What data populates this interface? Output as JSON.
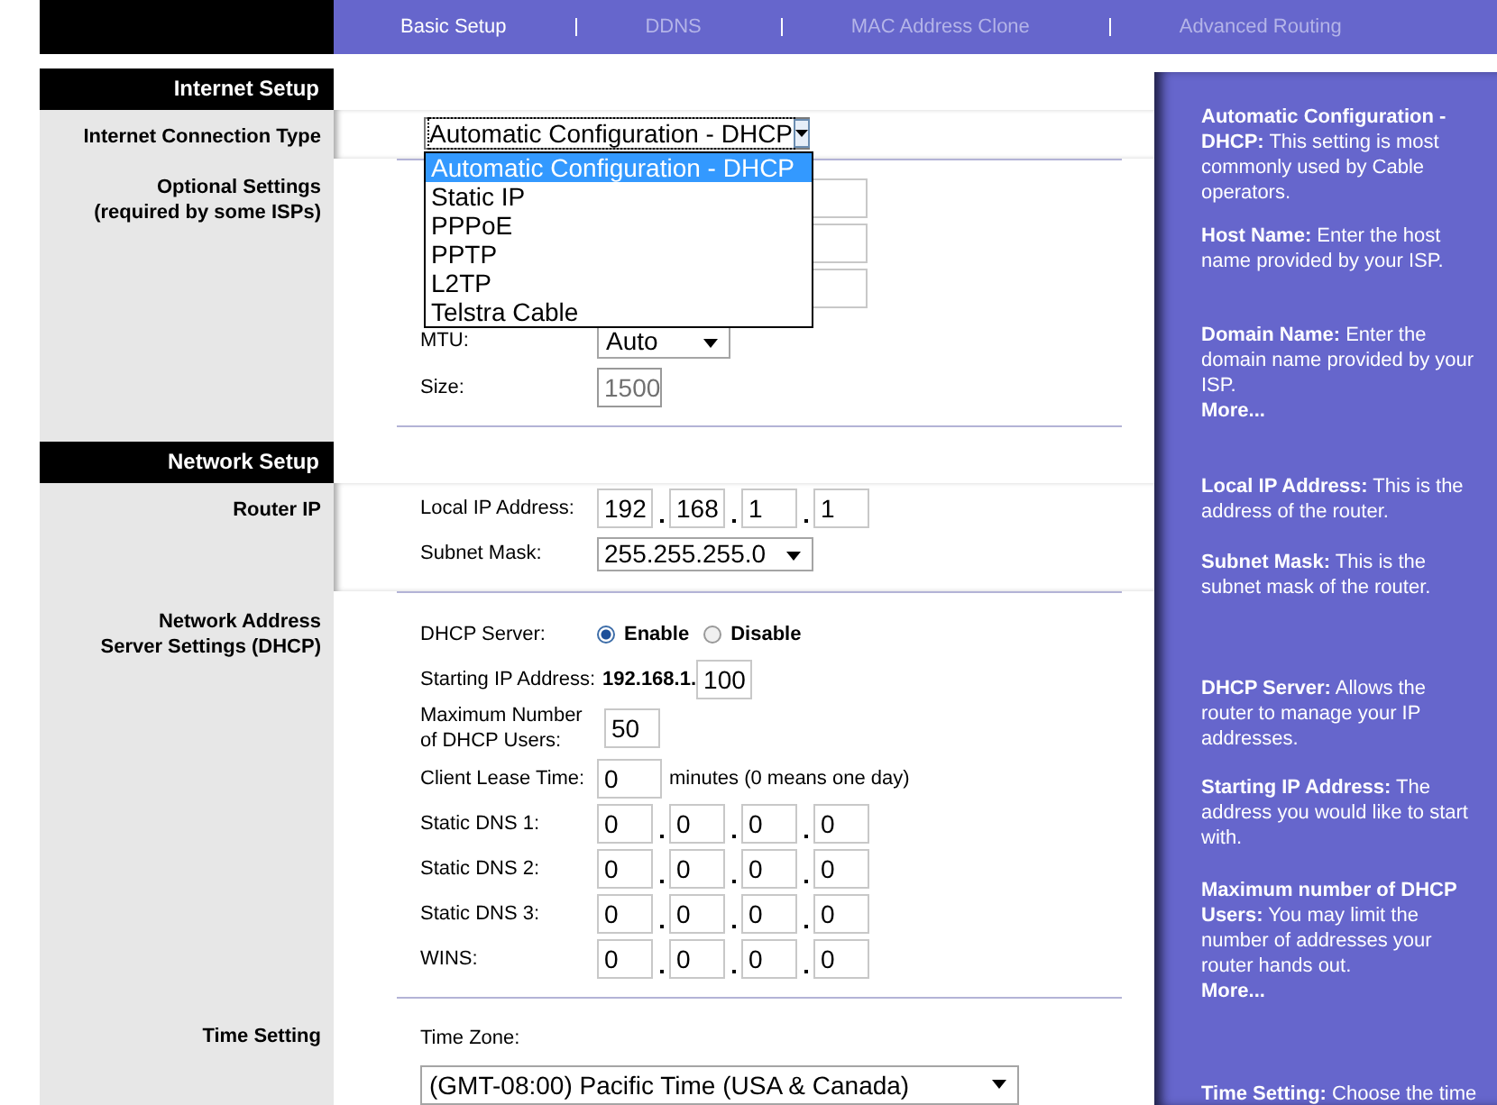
{
  "tabs": [
    {
      "label": "Basic Setup",
      "selected": true
    },
    {
      "label": "DDNS",
      "selected": false
    },
    {
      "label": "MAC Address Clone",
      "selected": false
    },
    {
      "label": "Advanced Routing",
      "selected": false
    }
  ],
  "internet_setup": {
    "title": "Internet Setup",
    "connection_type_label": "Internet Connection Type",
    "connection_type": {
      "value": "Automatic Configuration - DHCP",
      "expanded": true,
      "options": [
        {
          "label": "Automatic Configuration - DHCP",
          "selected": true
        },
        {
          "label": "Static IP",
          "selected": false
        },
        {
          "label": "PPPoE",
          "selected": false
        },
        {
          "label": "PPTP",
          "selected": false
        },
        {
          "label": "L2TP",
          "selected": false
        },
        {
          "label": "Telstra Cable",
          "selected": false
        }
      ]
    },
    "optional_label": "Optional Settings\n(required by some ISPs)",
    "mtu": {
      "label": "MTU:",
      "value": "Auto"
    },
    "size": {
      "label": "Size:",
      "value": "1500",
      "disabled": true
    }
  },
  "network_setup": {
    "title": "Network Setup",
    "router_ip_label": "Router IP",
    "local_ip": {
      "label": "Local IP Address:",
      "octets": [
        "192",
        "168",
        "1",
        "1"
      ]
    },
    "subnet_mask": {
      "label": "Subnet Mask:",
      "value": "255.255.255.0"
    },
    "dhcp_label": "Network Address\nServer Settings (DHCP)",
    "dhcp_server": {
      "label": "DHCP Server:",
      "options": [
        {
          "label": "Enable",
          "selected": true
        },
        {
          "label": "Disable",
          "selected": false
        }
      ]
    },
    "starting_ip": {
      "label": "Starting IP Address:",
      "prefix": "192.168.1.",
      "value": "100"
    },
    "max_users": {
      "label": "Maximum Number of DHCP Users:",
      "value": "50"
    },
    "lease_time": {
      "label": "Client Lease Time:",
      "value": "0",
      "suffix": "minutes (0 means one day)"
    },
    "addresses": [
      {
        "label": "Static DNS 1:",
        "octets": [
          "0",
          "0",
          "0",
          "0"
        ]
      },
      {
        "label": "Static DNS 2:",
        "octets": [
          "0",
          "0",
          "0",
          "0"
        ]
      },
      {
        "label": "Static DNS 3:",
        "octets": [
          "0",
          "0",
          "0",
          "0"
        ]
      },
      {
        "label": "WINS:",
        "octets": [
          "0",
          "0",
          "0",
          "0"
        ]
      }
    ]
  },
  "time_setting": {
    "title": "Time Setting",
    "label": "Time Zone:",
    "value": "(GMT-08:00) Pacific Time (USA & Canada)"
  },
  "help": [
    {
      "kind": "text",
      "text": "**Automatic Configuration - DHCP:** This setting is most commonly used by Cable operators."
    },
    {
      "kind": "text",
      "text": "**Host Name:** Enter the host name provided by your ISP."
    },
    {
      "kind": "text",
      "text": "**Domain Name:** Enter the domain name provided by your ISP."
    },
    {
      "kind": "more",
      "text": "More..."
    },
    {
      "kind": "text",
      "text": "**Local IP Address:** This is the address of the router."
    },
    {
      "kind": "text",
      "text": "**Subnet Mask:** This is the subnet mask of the router."
    },
    {
      "kind": "text",
      "text": "**DHCP Server:** Allows the router to manage your IP addresses."
    },
    {
      "kind": "text",
      "text": "**Starting IP Address:** The address you would like to start with."
    },
    {
      "kind": "text",
      "text": "**Maximum number of DHCP Users:** You may limit the number of addresses your router hands out."
    },
    {
      "kind": "more",
      "text": "More..."
    },
    {
      "kind": "text",
      "text": "**Time Setting:** Choose the time"
    }
  ]
}
